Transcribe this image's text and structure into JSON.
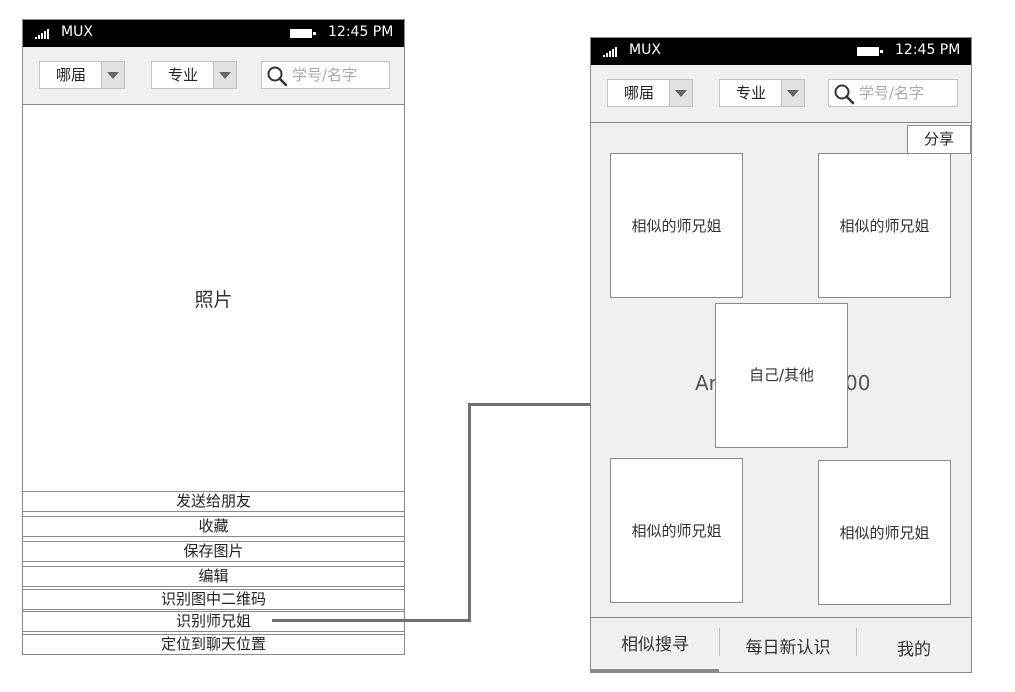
{
  "status_bar": {
    "carrier": "MUX",
    "time": "12:45 PM"
  },
  "filters": {
    "year_label": "哪届",
    "major_label": "专业",
    "search_placeholder": "学号/名字"
  },
  "left_screen": {
    "photo_label": "照片",
    "actions": [
      "发送给朋友",
      "收藏",
      "保存图片",
      "编辑",
      "识别图中二维码",
      "识别师兄姐",
      "定位到聊天位置"
    ]
  },
  "right_screen": {
    "share_label": "分享",
    "card_label": "相似的师兄姐",
    "center_card_label": "自己/其他",
    "background_text_left": "Ar",
    "background_text_right": "00",
    "tabs": [
      "相似搜寻",
      "每日新认识",
      "我的"
    ]
  },
  "icons": {
    "signal": "signal-bars-icon",
    "battery": "battery-icon",
    "search": "magnifier-icon",
    "dropdown": "caret-down-icon"
  },
  "colors": {
    "status_bar": "#000000",
    "panel_bg": "#f0f0f0",
    "border": "#8a8a8a",
    "connector": "#707070"
  }
}
